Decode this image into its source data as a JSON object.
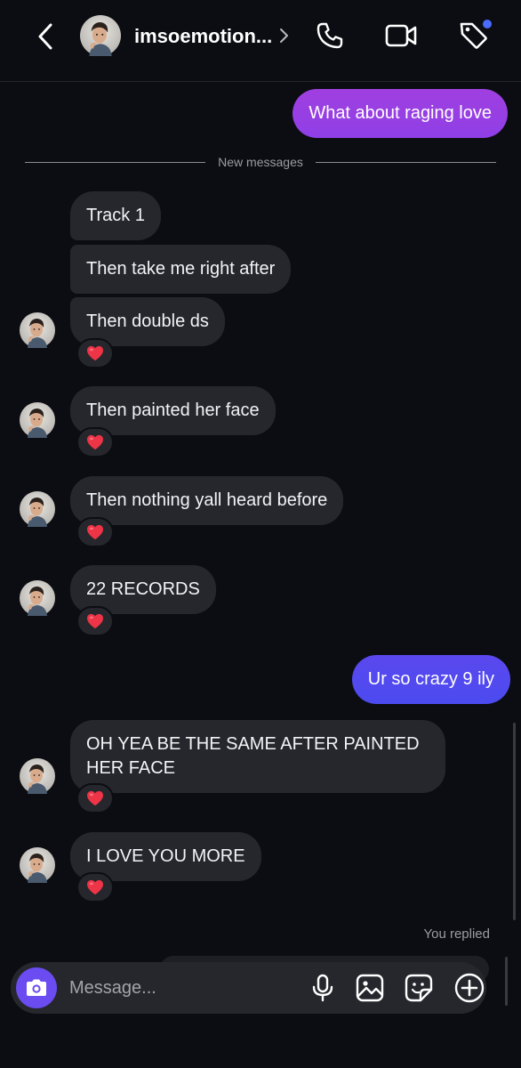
{
  "header": {
    "back_icon": "chevron-left-icon",
    "username": "imsoemotion...",
    "chevron_icon": "chevron-right-icon",
    "actions": [
      "phone-icon",
      "video-camera-icon",
      "tag-icon"
    ],
    "notification_dot_color": "#4a6cff"
  },
  "divider": {
    "label": "New messages"
  },
  "messages": {
    "m0": {
      "text": "What about raging love",
      "from": "me"
    },
    "m1": {
      "text": "Track 1",
      "from": "them"
    },
    "m2": {
      "text": "Then take me right after",
      "from": "them"
    },
    "m3": {
      "text": "Then double ds",
      "from": "them",
      "reaction": "❤️"
    },
    "m4": {
      "text": "Then painted her face",
      "from": "them",
      "reaction": "❤️"
    },
    "m5": {
      "text": "Then nothing yall heard before",
      "from": "them",
      "reaction": "❤️"
    },
    "m6": {
      "text": "22 RECORDS",
      "from": "them",
      "reaction": "❤️"
    },
    "m7": {
      "text": "Ur so crazy 9 ily",
      "from": "me"
    },
    "m8": {
      "text": "OH YEA BE THE SAME AFTER PAINTED HER FACE",
      "from": "them",
      "reaction": "❤️"
    },
    "m9": {
      "text": "I LOVE YOU MORE",
      "from": "them",
      "reaction": "❤️"
    }
  },
  "status": {
    "you_replied": "You replied"
  },
  "composer": {
    "camera_icon": "camera-icon",
    "placeholder": "Message...",
    "actions": [
      "microphone-icon",
      "gallery-icon",
      "sticker-icon",
      "plus-circle-icon"
    ]
  },
  "colors": {
    "background": "#0c0d12",
    "incoming_bubble": "#26272d",
    "outgoing_gradient_top": "#a03fe0",
    "outgoing_gradient_bottom": "#4b4bf0",
    "camera_button": "#6a4cf0"
  }
}
